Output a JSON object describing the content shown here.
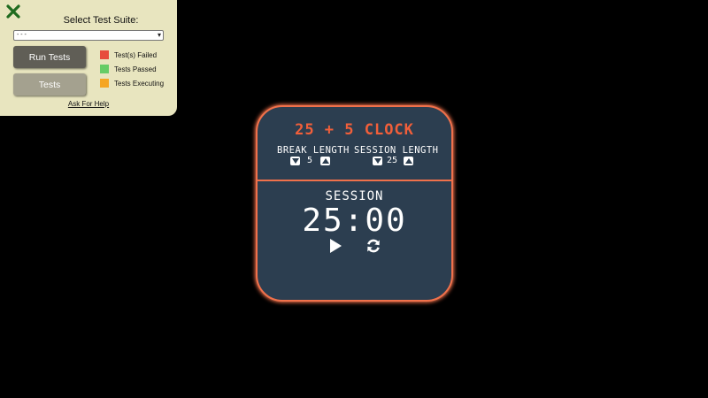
{
  "test_panel": {
    "title": "Select Test Suite:",
    "select_value": "- - -",
    "run_button": "Run Tests",
    "tests_button": "Tests",
    "legend": [
      {
        "label": "Test(s) Failed",
        "color": "#e74c3c"
      },
      {
        "label": "Tests Passed",
        "color": "#66cc66"
      },
      {
        "label": "Tests Executing",
        "color": "#f5a623"
      }
    ],
    "help_link": "Ask For Help"
  },
  "clock": {
    "title": "25 + 5 CLOCK",
    "break_label": "BREAK LENGTH",
    "break_value": "5",
    "session_label": "SESSION LENGTH",
    "session_value": "25",
    "timer_label": "SESSION",
    "time_left": "25:00",
    "accent_color": "#f0714b"
  }
}
